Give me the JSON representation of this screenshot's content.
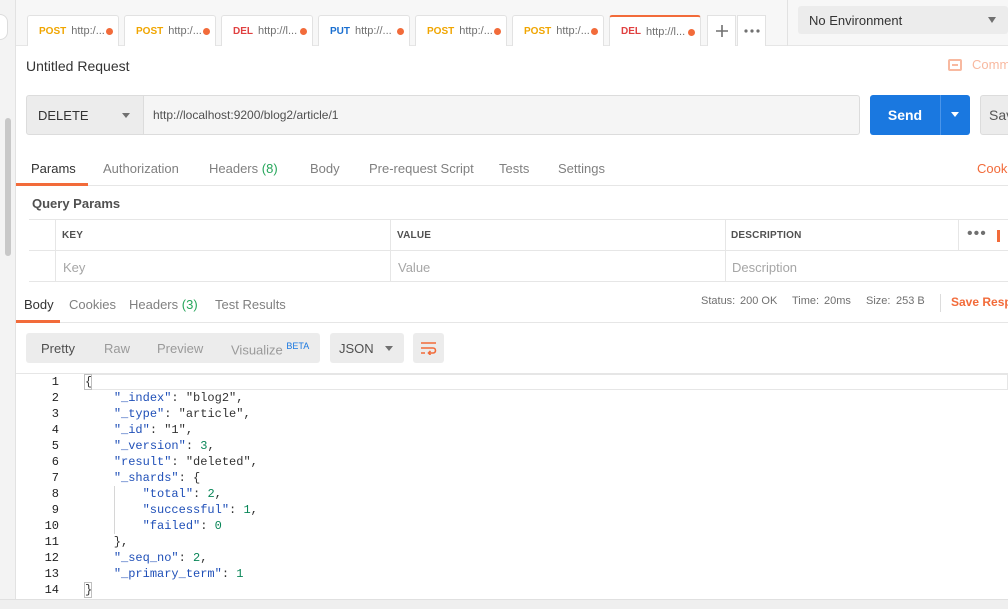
{
  "tabs": [
    {
      "method": "POST",
      "url": "http:/...",
      "active": false
    },
    {
      "method": "POST",
      "url": "http:/...",
      "active": false
    },
    {
      "method": "DEL",
      "url": "http://l...",
      "active": false
    },
    {
      "method": "PUT",
      "url": "http://...",
      "active": false
    },
    {
      "method": "POST",
      "url": "http:/...",
      "active": false
    },
    {
      "method": "POST",
      "url": "http:/...",
      "active": false
    },
    {
      "method": "DEL",
      "url": "http://l...",
      "active": true
    }
  ],
  "tab_actions": {
    "add_icon": "plus-icon",
    "more_icon": "more-horizontal-icon"
  },
  "environment": {
    "selected": "No Environment"
  },
  "request": {
    "title": "Untitled Request",
    "comments_label": "Comments",
    "method": "DELETE",
    "url": "http://localhost:9200/blog2/article/1",
    "send_label": "Send",
    "save_label": "Save"
  },
  "request_tabs": {
    "params": "Params",
    "authorization": "Authorization",
    "headers": "Headers",
    "headers_count": "(8)",
    "body": "Body",
    "prerequest": "Pre-request Script",
    "tests": "Tests",
    "settings": "Settings",
    "cookies": "Cookies"
  },
  "query_params": {
    "title": "Query Params",
    "headers": {
      "key": "KEY",
      "value": "VALUE",
      "description": "DESCRIPTION"
    },
    "placeholders": {
      "key": "Key",
      "value": "Value",
      "description": "Description"
    }
  },
  "response_tabs": {
    "body": "Body",
    "cookies": "Cookies",
    "headers": "Headers",
    "headers_count": "(3)",
    "test_results": "Test Results"
  },
  "response_meta": {
    "status_label": "Status:",
    "status_value": "200 OK",
    "time_label": "Time:",
    "time_value": "20ms",
    "size_label": "Size:",
    "size_value": "253 B",
    "save_response": "Save Response"
  },
  "view_modes": {
    "pretty": "Pretty",
    "raw": "Raw",
    "preview": "Preview",
    "visualize": "Visualize",
    "beta": "BETA"
  },
  "format": "JSON",
  "colors": {
    "accent": "#f26b3a",
    "send": "#1a78e0",
    "success": "#26a65b"
  },
  "code_lines": [
    {
      "n": "1",
      "tokens": [
        [
          "p",
          "{"
        ]
      ]
    },
    {
      "n": "2",
      "tokens": [
        [
          "p",
          "    "
        ],
        [
          "k",
          "\"_index\""
        ],
        [
          "p",
          ": "
        ],
        [
          "s",
          "\"blog2\""
        ],
        [
          "p",
          ","
        ]
      ]
    },
    {
      "n": "3",
      "tokens": [
        [
          "p",
          "    "
        ],
        [
          "k",
          "\"_type\""
        ],
        [
          "p",
          ": "
        ],
        [
          "s",
          "\"article\""
        ],
        [
          "p",
          ","
        ]
      ]
    },
    {
      "n": "4",
      "tokens": [
        [
          "p",
          "    "
        ],
        [
          "k",
          "\"_id\""
        ],
        [
          "p",
          ": "
        ],
        [
          "s",
          "\"1\""
        ],
        [
          "p",
          ","
        ]
      ]
    },
    {
      "n": "5",
      "tokens": [
        [
          "p",
          "    "
        ],
        [
          "k",
          "\"_version\""
        ],
        [
          "p",
          ": "
        ],
        [
          "n",
          "3"
        ],
        [
          "p",
          ","
        ]
      ]
    },
    {
      "n": "6",
      "tokens": [
        [
          "p",
          "    "
        ],
        [
          "k",
          "\"result\""
        ],
        [
          "p",
          ": "
        ],
        [
          "s",
          "\"deleted\""
        ],
        [
          "p",
          ","
        ]
      ]
    },
    {
      "n": "7",
      "tokens": [
        [
          "p",
          "    "
        ],
        [
          "k",
          "\"_shards\""
        ],
        [
          "p",
          ": {"
        ]
      ]
    },
    {
      "n": "8",
      "tokens": [
        [
          "p",
          "        "
        ],
        [
          "k",
          "\"total\""
        ],
        [
          "p",
          ": "
        ],
        [
          "n",
          "2"
        ],
        [
          "p",
          ","
        ]
      ]
    },
    {
      "n": "9",
      "tokens": [
        [
          "p",
          "        "
        ],
        [
          "k",
          "\"successful\""
        ],
        [
          "p",
          ": "
        ],
        [
          "n",
          "1"
        ],
        [
          "p",
          ","
        ]
      ]
    },
    {
      "n": "10",
      "tokens": [
        [
          "p",
          "        "
        ],
        [
          "k",
          "\"failed\""
        ],
        [
          "p",
          ": "
        ],
        [
          "n",
          "0"
        ]
      ]
    },
    {
      "n": "11",
      "tokens": [
        [
          "p",
          "    },"
        ]
      ]
    },
    {
      "n": "12",
      "tokens": [
        [
          "p",
          "    "
        ],
        [
          "k",
          "\"_seq_no\""
        ],
        [
          "p",
          ": "
        ],
        [
          "n",
          "2"
        ],
        [
          "p",
          ","
        ]
      ]
    },
    {
      "n": "13",
      "tokens": [
        [
          "p",
          "    "
        ],
        [
          "k",
          "\"_primary_term\""
        ],
        [
          "p",
          ": "
        ],
        [
          "n",
          "1"
        ]
      ]
    },
    {
      "n": "14",
      "tokens": [
        [
          "p",
          "}"
        ]
      ]
    }
  ]
}
